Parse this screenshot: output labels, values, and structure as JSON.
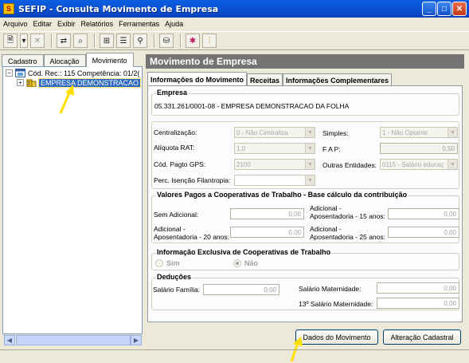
{
  "window": {
    "title": "SEFIP - Consulta Movimento de Empresa",
    "icon_text": "S"
  },
  "menu": [
    "Arquivo",
    "Editar",
    "Exibir",
    "Relatórios",
    "Ferramentas",
    "Ajuda"
  ],
  "toolbar": [
    "new-icon",
    "dropdown-arrow-icon",
    "delete-icon",
    "move-icon",
    "find-icon",
    "list-icon",
    "binoculars-icon",
    "database-icon",
    "color-icon",
    "chart-icon"
  ],
  "left_tabs": [
    "Cadastro",
    "Alocação",
    "Movimento"
  ],
  "tree": {
    "root": "Cód. Rec.: 115 Competência: 01/2(",
    "child": "EMPRESA DEMONSTRACAO"
  },
  "right": {
    "header": "Movimento de Empresa",
    "tabs": [
      "Informações do Movimento",
      "Receitas",
      "Informações Complementares"
    ],
    "empresa": {
      "title": "Empresa",
      "value": "05.331.261/0001-08 - EMPRESA DEMONSTRACAO DA FOLHA"
    },
    "fields": {
      "centralizacao": {
        "label": "Centralização:",
        "value": "0 - Não Centraliza"
      },
      "simples": {
        "label": "Simples:",
        "value": "1 - Não Optante"
      },
      "aliquota": {
        "label": "Alíquota RAT:",
        "value": "1,0"
      },
      "fap": {
        "label": "F A P:",
        "value": "0,50"
      },
      "pagto_gps": {
        "label": "Cód. Pagto GPS:",
        "value": "2100"
      },
      "outras": {
        "label": "Outras Entidades:",
        "value": "0115 - Salário educaç"
      },
      "isencao": {
        "label": "Perc. Isenção Filantropia:",
        "value": ""
      }
    },
    "coop": {
      "title": "Valores Pagos a Cooperativas de Trabalho - Base cálculo da contribuição",
      "sem_adicional": {
        "label": "Sem Adicional:",
        "value": "0,00"
      },
      "ad15_a": "Adicional -",
      "ad15_b": "Aposentadoria - 15 anos:",
      "ad15_value": "0,00",
      "ad20_a": "Adicional -",
      "ad20_b": "Aposentadoria - 20 anos:",
      "ad20_value": "0,00",
      "ad25_a": "Adicional -",
      "ad25_b": "Aposentadoria - 25 anos:",
      "ad25_value": "0,00"
    },
    "exclusiva": {
      "title": "Informação Exclusiva de Cooperativas de Trabalho",
      "sim": "Sim",
      "nao": "Não",
      "selected": "Não"
    },
    "deducoes": {
      "title": "Deduções",
      "salario_familia": {
        "label": "Salário Família:",
        "value": "0,00"
      },
      "salario_maternidade": {
        "label": "Salário Maternidade:",
        "value": "0,00"
      },
      "decimo_maternidade": {
        "label": "13º Salário Maternidade:",
        "value": "0,00"
      }
    },
    "buttons": {
      "dados": "Dados do Movimento",
      "alteracao": "Alteração Cadastral"
    }
  },
  "colors": {
    "accent": "#316ac5",
    "titlebar": "#0b4fd0",
    "header": "#747474",
    "arrow": "#ffe000"
  }
}
